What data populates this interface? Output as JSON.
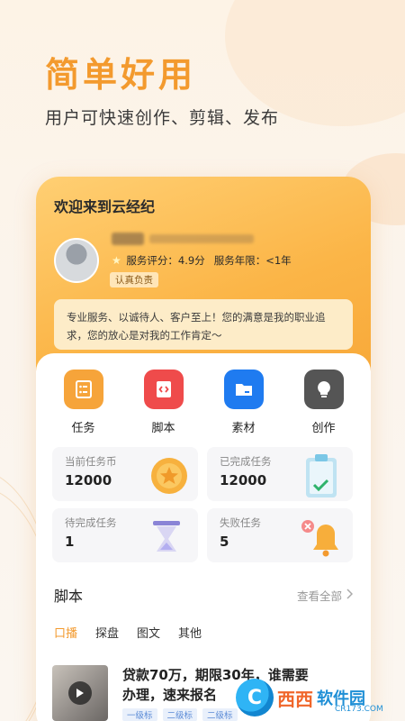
{
  "hero": {
    "title": "简单好用",
    "subtitle": "用户可快速创作、剪辑、发布"
  },
  "profile": {
    "welcome": "欢迎来到云经纪",
    "service_rating_label": "服务评分：",
    "service_rating_value": "4.9分",
    "service_years_label": "服务年限：",
    "service_years_value": "<1年",
    "badge": "认真负责",
    "motto": "专业服务、以诚待人、客户至上！您的满意是我的职业追求，您的放心是对我的工作肯定～"
  },
  "quick_actions": [
    {
      "label": "任务",
      "icon": "task-icon",
      "color": "#f6a43a"
    },
    {
      "label": "脚本",
      "icon": "code-icon",
      "color": "#ef4b4b"
    },
    {
      "label": "素材",
      "icon": "folder-icon",
      "color": "#1f7bf0"
    },
    {
      "label": "创作",
      "icon": "bulb-icon",
      "color": "#555555"
    }
  ],
  "stats": [
    {
      "label": "当前任务币",
      "value": "12000",
      "art": "coin-icon"
    },
    {
      "label": "已完成任务",
      "value": "12000",
      "art": "checklist-icon"
    },
    {
      "label": "待完成任务",
      "value": "1",
      "art": "hourglass-icon"
    },
    {
      "label": "失败任务",
      "value": "5",
      "art": "bell-icon"
    }
  ],
  "scripts_section": {
    "title": "脚本",
    "see_all": "查看全部"
  },
  "tabs": [
    "口播",
    "探盘",
    "图文",
    "其他"
  ],
  "article": {
    "title": "贷款70万，期限30年，谁需要办理，速来报名",
    "tags": [
      "一级标",
      "二级标",
      "二级标"
    ]
  },
  "watermark": {
    "text1": "西西",
    "text2": "软件园",
    "sub": "CR173.COM"
  },
  "colors": {
    "accent": "#f39a2e",
    "header_gradient": "#fbb547"
  }
}
